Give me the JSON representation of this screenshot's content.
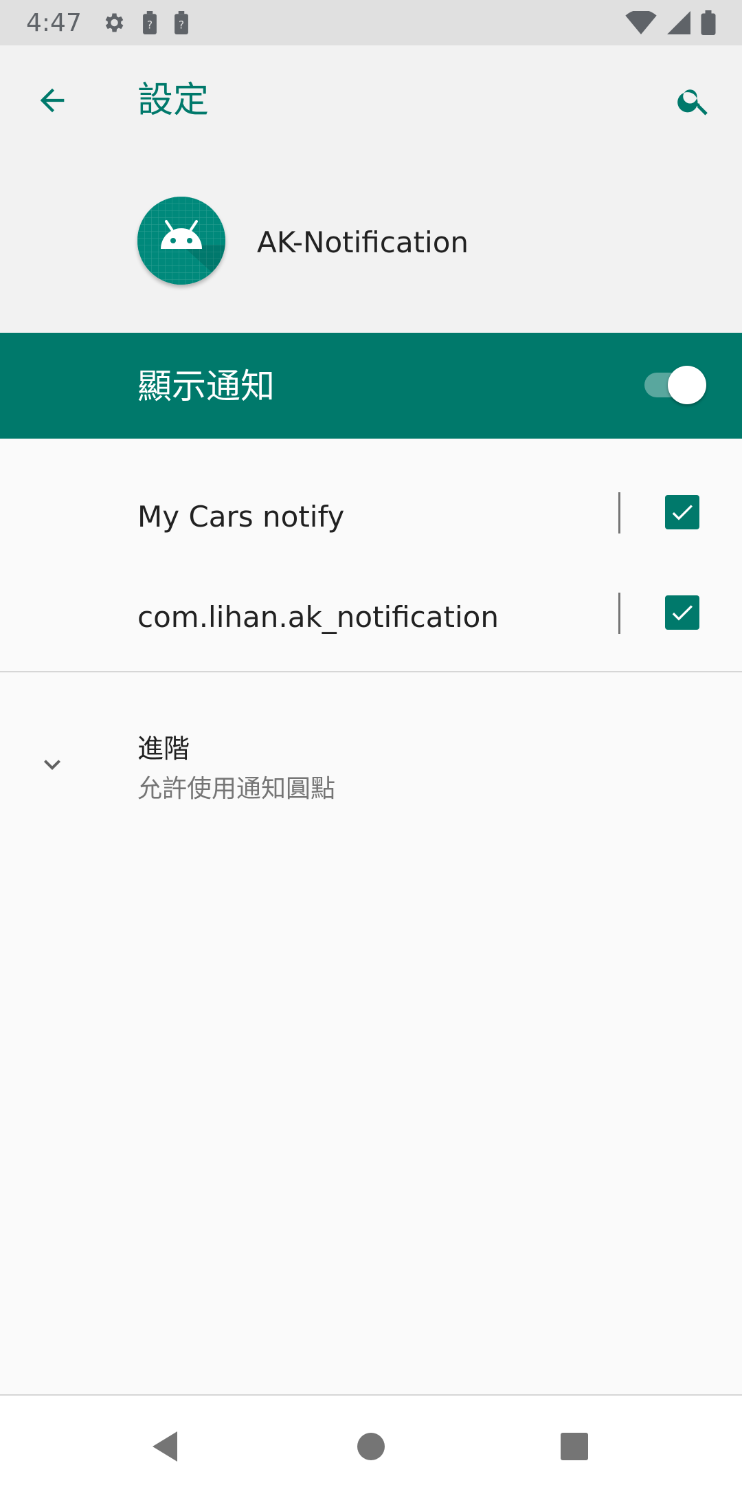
{
  "status_bar": {
    "time": "4:47",
    "left_icons": [
      "gear-icon",
      "battery-unknown-icon",
      "battery-unknown-icon"
    ],
    "right_icons": [
      "wifi-icon",
      "cell-signal-icon",
      "battery-icon"
    ]
  },
  "toolbar": {
    "title": "設定",
    "back_icon": "arrow-back-icon",
    "search_icon": "search-icon"
  },
  "app": {
    "name": "AK-Notification",
    "icon": "android-icon"
  },
  "master_switch": {
    "label": "顯示通知",
    "enabled": true
  },
  "channels": [
    {
      "label": "My Cars notify",
      "checked": true
    },
    {
      "label": "com.lihan.ak_notification",
      "checked": true
    }
  ],
  "advanced": {
    "title": "進階",
    "summary": "允許使用通知圓點"
  },
  "colors": {
    "accent": "#00796b",
    "status_bar": "#e0e0e0",
    "header_bg": "#f2f2f2",
    "background": "#fafafa"
  }
}
